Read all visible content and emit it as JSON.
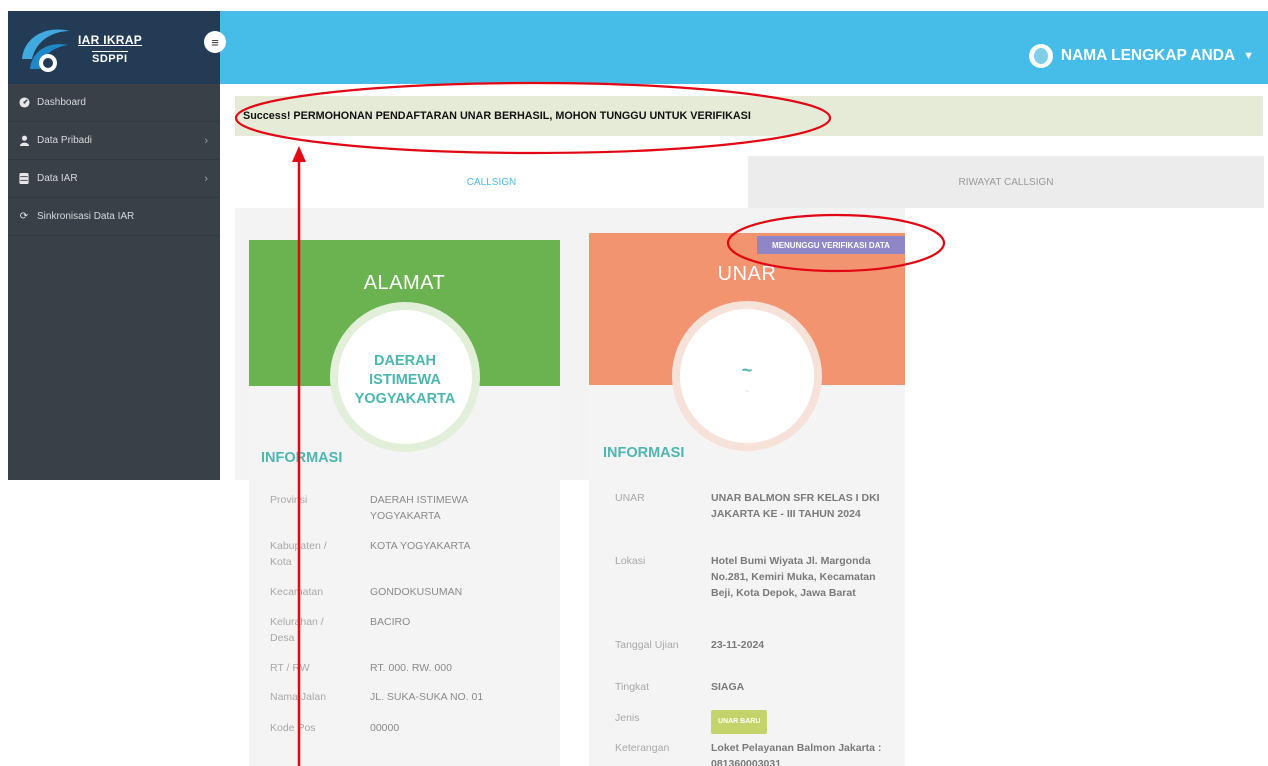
{
  "brand": {
    "line1": "IAR IKRAP",
    "line2": "SDPPI"
  },
  "header": {
    "menu_icon": "hamburger-icon",
    "user_name": "NAMA LENGKAP ANDA",
    "caret": "▼",
    "accent": "#46bde8"
  },
  "sidebar": {
    "items": [
      {
        "icon": "dashboard-icon",
        "label": "Dashboard",
        "has_chevron": false
      },
      {
        "icon": "user-icon",
        "label": "Data Pribadi",
        "has_chevron": true
      },
      {
        "icon": "database-icon",
        "label": "Data IAR",
        "has_chevron": true
      },
      {
        "icon": "sync-icon",
        "label": "Sinkronisasi Data IAR",
        "has_chevron": false
      }
    ]
  },
  "alert": {
    "text": "Success! PERMOHONAN PENDAFTARAN UNAR BERHASIL, MOHON TUNGGU UNTUK VERIFIKASI"
  },
  "tabs": [
    {
      "label": "CALLSIGN",
      "active": true
    },
    {
      "label": "RIWAYAT CALLSIGN",
      "active": false
    }
  ],
  "alamat_card": {
    "title": "ALAMAT",
    "circle_lines": [
      "DAERAH",
      "ISTIMEWA",
      "YOGYAKARTA"
    ],
    "info_title": "INFORMASI",
    "rows": [
      {
        "key": "Provinsi",
        "value": "DAERAH ISTIMEWA YOGYAKARTA"
      },
      {
        "key": "Kabupaten / Kota",
        "value": "KOTA YOGYAKARTA"
      },
      {
        "key": "Kecamatan",
        "value": "GONDOKUSUMAN"
      },
      {
        "key": "Kelurahan / Desa",
        "value": "BACIRO"
      },
      {
        "key": "RT / RW",
        "value": "RT. 000. RW. 000"
      },
      {
        "key": "Nama Jalan",
        "value": "JL. SUKA-SUKA NO. 01"
      },
      {
        "key": "Kode Pos",
        "value": "00000"
      }
    ]
  },
  "unar_card": {
    "title": "UNAR",
    "status_badge": "MENUNGGU VERIFIKASI DATA",
    "circle_main": "~",
    "circle_sub": "~",
    "info_title": "INFORMASI",
    "rows": [
      {
        "key": "UNAR",
        "value": "UNAR BALMON SFR KELAS I DKI JAKARTA KE - III TAHUN 2024"
      },
      {
        "key": "Lokasi",
        "value": "Hotel Bumi Wiyata Jl. Margonda No.281, Kemiri Muka, Kecamatan Beji, Kota Depok, Jawa Barat"
      },
      {
        "key": "Tanggal Ujian",
        "value": "23-11-2024"
      },
      {
        "key": "Tingkat",
        "value": "SIAGA"
      },
      {
        "key": "Jenis",
        "value": "UNAR BARU"
      },
      {
        "key": "Keterangan",
        "value": "Loket Pelayanan Balmon Jakarta : 081360003031"
      }
    ]
  },
  "colors": {
    "alamat": "#6ab350",
    "unar": "#f29470",
    "badge": "#8f86c8",
    "info": "#4cb6b0",
    "annotation": "#e30613"
  }
}
